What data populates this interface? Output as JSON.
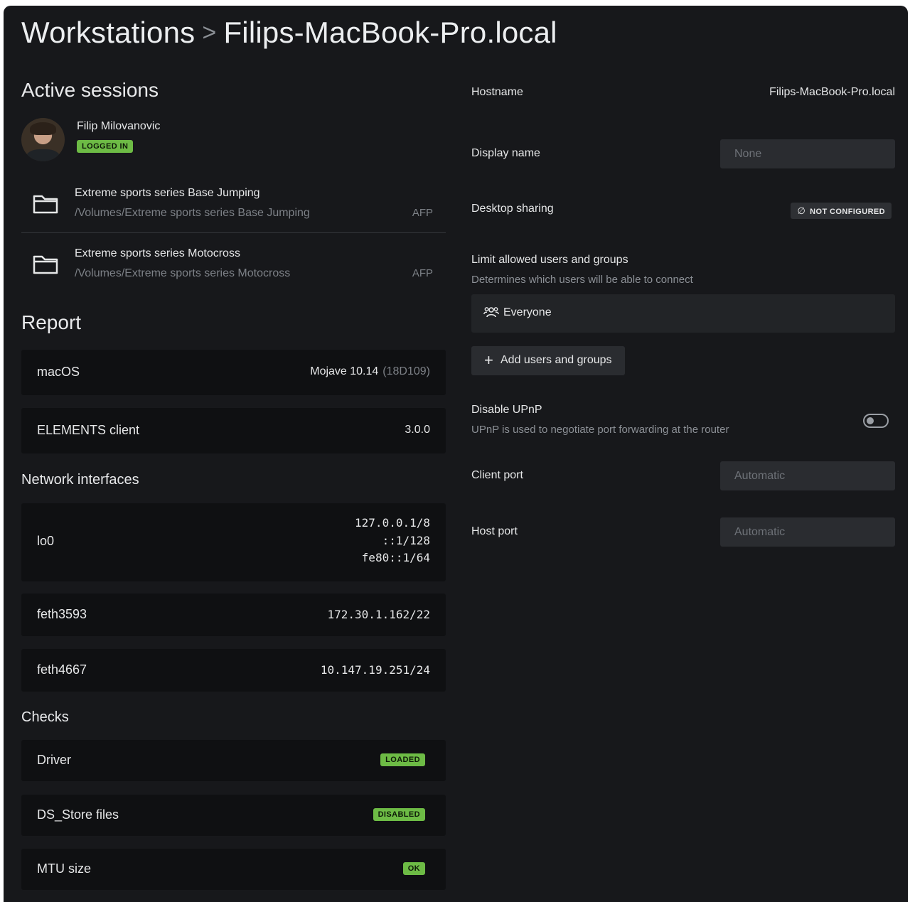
{
  "header": {
    "breadcrumb_root": "Workstations",
    "separator": ">",
    "page_title": "Filips-MacBook-Pro.local"
  },
  "active_sessions": {
    "heading": "Active sessions",
    "user": {
      "name": "Filip Milovanovic",
      "status": "LOGGED IN"
    },
    "shares": [
      {
        "name": "Extreme sports series Base Jumping",
        "path": "/Volumes/Extreme sports series Base Jumping",
        "protocol": "AFP"
      },
      {
        "name": "Extreme sports series Motocross",
        "path": "/Volumes/Extreme sports series Motocross",
        "protocol": "AFP"
      }
    ]
  },
  "report": {
    "heading": "Report",
    "os": {
      "label": "macOS",
      "value": "Mojave 10.14",
      "build": "(18D109)"
    },
    "client": {
      "label": "ELEMENTS client",
      "value": "3.0.0"
    }
  },
  "network": {
    "heading": "Network interfaces",
    "interfaces": [
      {
        "name": "lo0",
        "addresses": [
          "127.0.0.1/8",
          "::1/128",
          "fe80::1/64"
        ]
      },
      {
        "name": "feth3593",
        "addresses": [
          "172.30.1.162/22"
        ]
      },
      {
        "name": "feth4667",
        "addresses": [
          "10.147.19.251/24"
        ]
      }
    ]
  },
  "checks": {
    "heading": "Checks",
    "items": [
      {
        "label": "Driver",
        "status": "LOADED"
      },
      {
        "label": "DS_Store files",
        "status": "DISABLED"
      },
      {
        "label": "MTU size",
        "status": "OK"
      }
    ]
  },
  "settings": {
    "hostname_label": "Hostname",
    "hostname_value": "Filips-MacBook-Pro.local",
    "display_name_label": "Display name",
    "display_name_placeholder": "None",
    "desktop_sharing_label": "Desktop sharing",
    "desktop_sharing_status": "NOT CONFIGURED",
    "limit_label": "Limit allowed users and groups",
    "limit_sub": "Determines which users will be able to connect",
    "everyone_label": "Everyone",
    "add_users_label": "Add users and groups",
    "upnp_label": "Disable UPnP",
    "upnp_sub": "UPnP is used to negotiate port forwarding at the router",
    "upnp_enabled": false,
    "client_port_label": "Client port",
    "client_port_placeholder": "Automatic",
    "host_port_label": "Host port",
    "host_port_placeholder": "Automatic"
  },
  "icons": {
    "folder": "folder-icon",
    "users": "users-icon",
    "plus": "plus-icon",
    "not_configured": "empty-set-icon"
  },
  "colors": {
    "background": "#17181b",
    "card": "#0f1012",
    "success_badge": "#6dbb45",
    "ip_address": "#e0893a"
  }
}
